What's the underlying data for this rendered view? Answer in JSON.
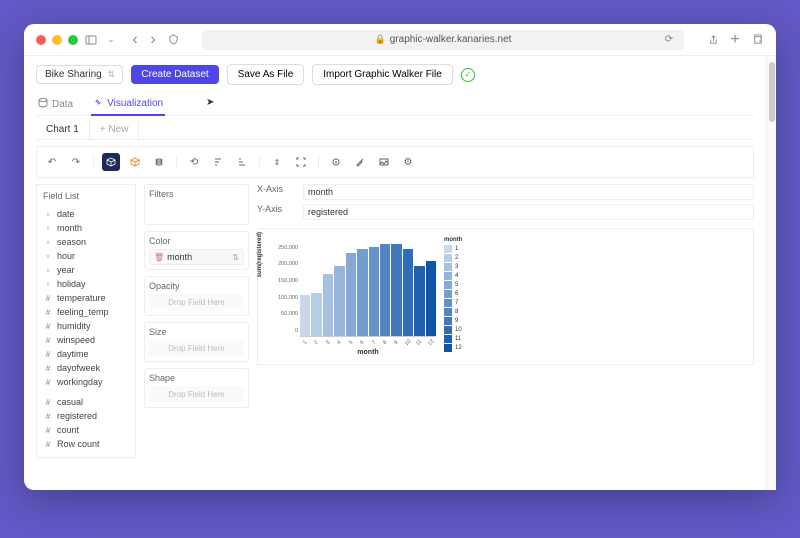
{
  "browser": {
    "url": "graphic-walker.kanaries.net"
  },
  "topbar": {
    "dataset": "Bike Sharing",
    "create": "Create Dataset",
    "save": "Save As File",
    "import": "Import Graphic Walker File"
  },
  "tabs": {
    "data": "Data",
    "viz": "Visualization"
  },
  "charttabs": {
    "chart1": "Chart 1",
    "new": "+ New"
  },
  "fieldlist": {
    "title": "Field List",
    "dims": [
      "date",
      "month",
      "season",
      "hour",
      "year",
      "holiday"
    ],
    "meas_named": [
      "temperature",
      "feeling_temp",
      "humidity",
      "winspeed",
      "daytime",
      "dayofweek",
      "workingday"
    ],
    "meas_agg": [
      "casual",
      "registered",
      "count",
      "Row count"
    ]
  },
  "shelves": {
    "filters": "Filters",
    "color": "Color",
    "color_field": "month",
    "opacity": "Opacity",
    "size": "Size",
    "shape": "Shape",
    "drop": "Drop Field Here"
  },
  "axes": {
    "xlabel": "X-Axis",
    "xfield": "month",
    "ylabel": "Y-Axis",
    "yfield": "registered"
  },
  "chart_data": {
    "type": "bar",
    "categories": [
      "1",
      "2",
      "3",
      "4",
      "5",
      "6",
      "7",
      "8",
      "9",
      "10",
      "11",
      "12"
    ],
    "values": [
      124000,
      128000,
      185000,
      210000,
      250000,
      260000,
      268000,
      275000,
      275000,
      260000,
      210000,
      225000
    ],
    "ylim": [
      0,
      300000
    ],
    "yticks": [
      0,
      50000,
      100000,
      150000,
      200000,
      250000
    ],
    "ylabel": "sum(registered)",
    "xlabel": "month",
    "legend_title": "month",
    "colors": [
      "#c9d9ec",
      "#b8cde6",
      "#a7c1e0",
      "#96b5da",
      "#85a9d4",
      "#749dce",
      "#6391c8",
      "#5285c2",
      "#4179bc",
      "#306db6",
      "#1f61b0",
      "#0e55aa"
    ]
  }
}
